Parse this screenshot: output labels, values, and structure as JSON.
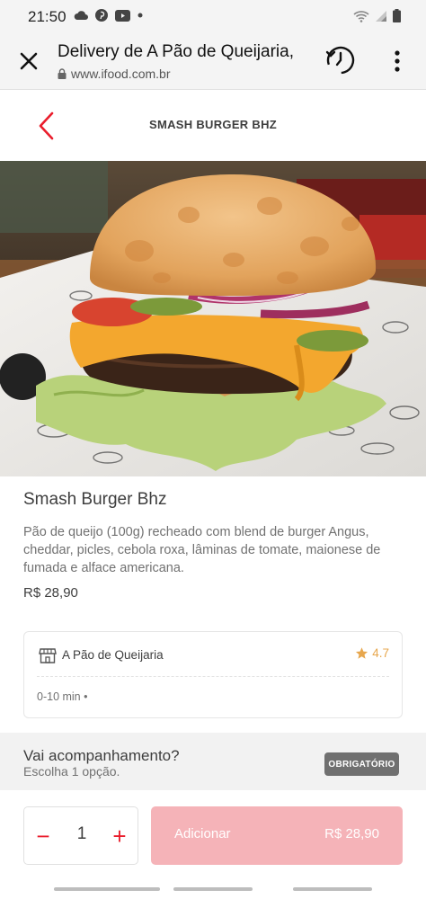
{
  "status_bar": {
    "time": "21:50",
    "icons": [
      "cloud-icon",
      "pinterest-icon",
      "youtube-icon",
      "dot-icon",
      "wifi-icon",
      "signal-icon",
      "battery-icon"
    ]
  },
  "browser": {
    "title": "Delivery de A Pão de Queijaria,",
    "url": "www.ifood.com.br"
  },
  "page_header": {
    "title": "SMASH BURGER BHZ"
  },
  "product": {
    "name": "Smash Burger Bhz",
    "description": "Pão de queijo (100g) recheado com blend de burger Angus, cheddar, picles, cebola roxa, lâminas de tomate, maionese de fumada e alface americana.",
    "price": "R$ 28,90"
  },
  "store": {
    "name": "A Pão de Queijaria",
    "rating": "4.7",
    "delivery_time": "0-10 min •"
  },
  "side_section": {
    "title": "Vai acompanhamento?",
    "subtitle": "Escolha 1 opção.",
    "badge": "OBRIGATÓRIO"
  },
  "cart": {
    "quantity": "1",
    "minus": "−",
    "plus": "+",
    "add_label": "Adicionar",
    "add_price": "R$ 28,90"
  },
  "colors": {
    "accent": "#ea1d2c",
    "button_disabled": "#f5b3b8",
    "rating": "#e7a74e",
    "badge": "#707070"
  }
}
